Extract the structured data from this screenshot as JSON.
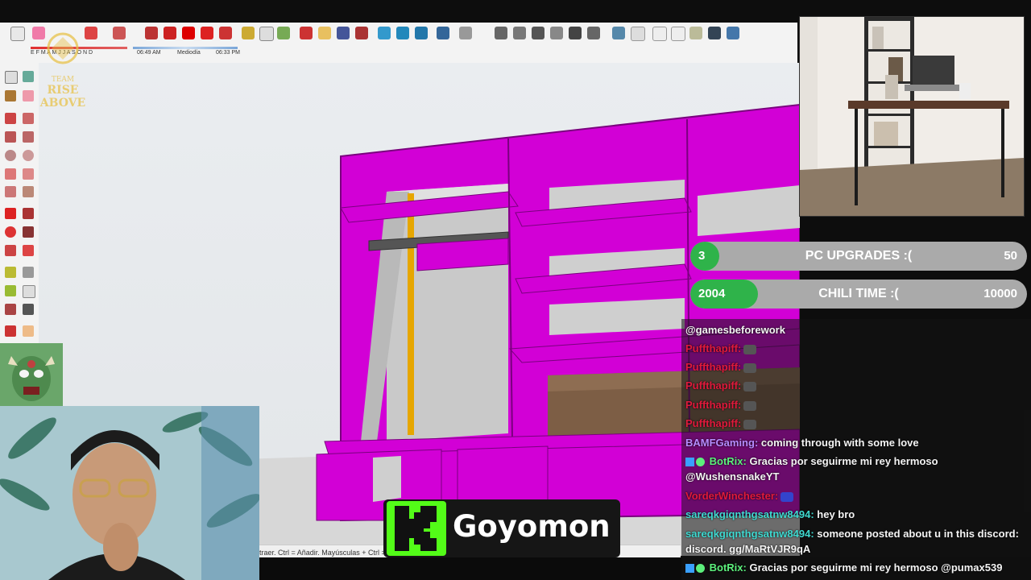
{
  "toolbar": {
    "shadow_time_start": "06:49 AM",
    "shadow_time_mid": "Mediodía",
    "shadow_time_end": "06:33 PM",
    "months": "E F M A M J J A S O N D"
  },
  "watermark": {
    "line1": "TEAM",
    "line2": "RISE ABOVE"
  },
  "status_bar": {
    "text": "traer. Ctrl = Añadir. Mayúsculas + Ctrl = ..."
  },
  "goals": [
    {
      "current": "3",
      "title": "PC UPGRADES :(",
      "target": "50",
      "progress": 0.06
    },
    {
      "current": "2004",
      "title": "CHILI TIME :(",
      "target": "10000",
      "progress": 0.2
    }
  ],
  "chat": {
    "messages": [
      {
        "user": "",
        "text": "@gamesbeforework",
        "color": "#ffffff"
      },
      {
        "user": "Puffthapiff:",
        "text": "",
        "color": "#e01a3c"
      },
      {
        "user": "Puffthapiff:",
        "text": "",
        "color": "#e01a3c"
      },
      {
        "user": "Puffthapiff:",
        "text": "",
        "color": "#e01a3c"
      },
      {
        "user": "Puffthapiff:",
        "text": "",
        "color": "#e01a3c"
      },
      {
        "user": "Puffthapiff:",
        "text": "",
        "color": "#e01a3c"
      },
      {
        "user": "BAMFGaming:",
        "text": "coming through with some love",
        "color": "#b68cff"
      },
      {
        "user": "BotRix:",
        "text": "Gracias por seguirme mi rey hermoso @WushensnakeYT",
        "color": "#5cf07c"
      },
      {
        "user": "VorderWinchester:",
        "text": "",
        "color": "#e01a3c"
      },
      {
        "user": "sareqkgiqnthgsatnw8494:",
        "text": "hey bro",
        "color": "#3fd9d0"
      },
      {
        "user": "sareqkgiqnthgsatnw8494:",
        "text": "someone posted about u in this discord: discord. gg/MaRtVJR9qA",
        "color": "#3fd9d0"
      },
      {
        "user": "BotRix:",
        "text": "Gracias por seguirme mi rey hermoso @pumax539",
        "color": "#5cf07c"
      }
    ]
  },
  "streamer": {
    "platform_icon": "kick-logo-icon",
    "name": "Goyomon"
  },
  "colors": {
    "cabinet": "#d000d8",
    "kick_green": "#53fc18"
  }
}
